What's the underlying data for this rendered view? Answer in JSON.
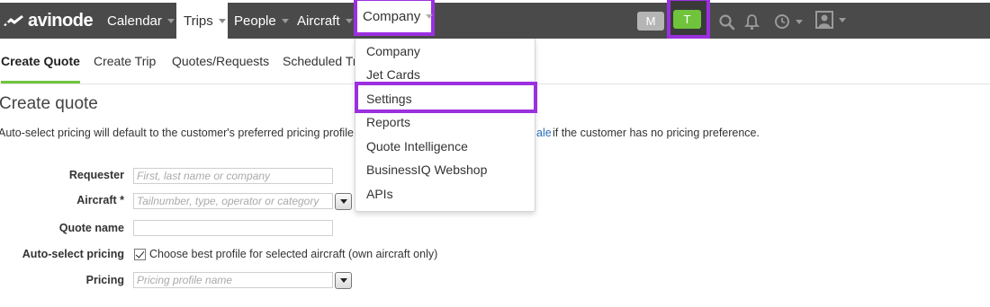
{
  "header": {
    "logo_text": "avinode",
    "nav": [
      {
        "label": "Calendar"
      },
      {
        "label": "Trips"
      },
      {
        "label": "People"
      },
      {
        "label": "Aircraft"
      },
      {
        "label": "Company"
      }
    ],
    "badge_m": "M",
    "badge_t": "T"
  },
  "subtabs": [
    {
      "label": "Create Quote"
    },
    {
      "label": "Create Trip"
    },
    {
      "label": "Quotes/Requests"
    },
    {
      "label": "Scheduled Tri"
    }
  ],
  "page": {
    "title": "Create quote",
    "info_prefix": "Auto-select pricing will default to the customer's preferred pricing profile typ",
    "info_link": "ale",
    "info_suffix": " if the customer has no pricing preference."
  },
  "form": {
    "requester_label": "Requester",
    "requester_placeholder": "First, last name or company",
    "aircraft_label": "Aircraft *",
    "aircraft_placeholder": "Tailnumber, type, operator or category",
    "quote_name_label": "Quote name",
    "auto_select_label": "Auto-select pricing",
    "auto_select_text": "Choose best profile for selected aircraft (own aircraft only)",
    "pricing_label": "Pricing",
    "pricing_placeholder": "Pricing profile name"
  },
  "dropdown": {
    "items": [
      {
        "label": "Company"
      },
      {
        "label": "Jet Cards"
      },
      {
        "label": "Settings"
      },
      {
        "label": "Reports"
      },
      {
        "label": "Quote Intelligence"
      },
      {
        "label": "BusinessIQ Webshop"
      },
      {
        "label": "APIs"
      }
    ]
  },
  "colors": {
    "topbar": "#4a4a4a",
    "accent_green": "#6fc43c",
    "highlight_purple": "#9b30e0",
    "link_blue": "#2a6ebb"
  }
}
